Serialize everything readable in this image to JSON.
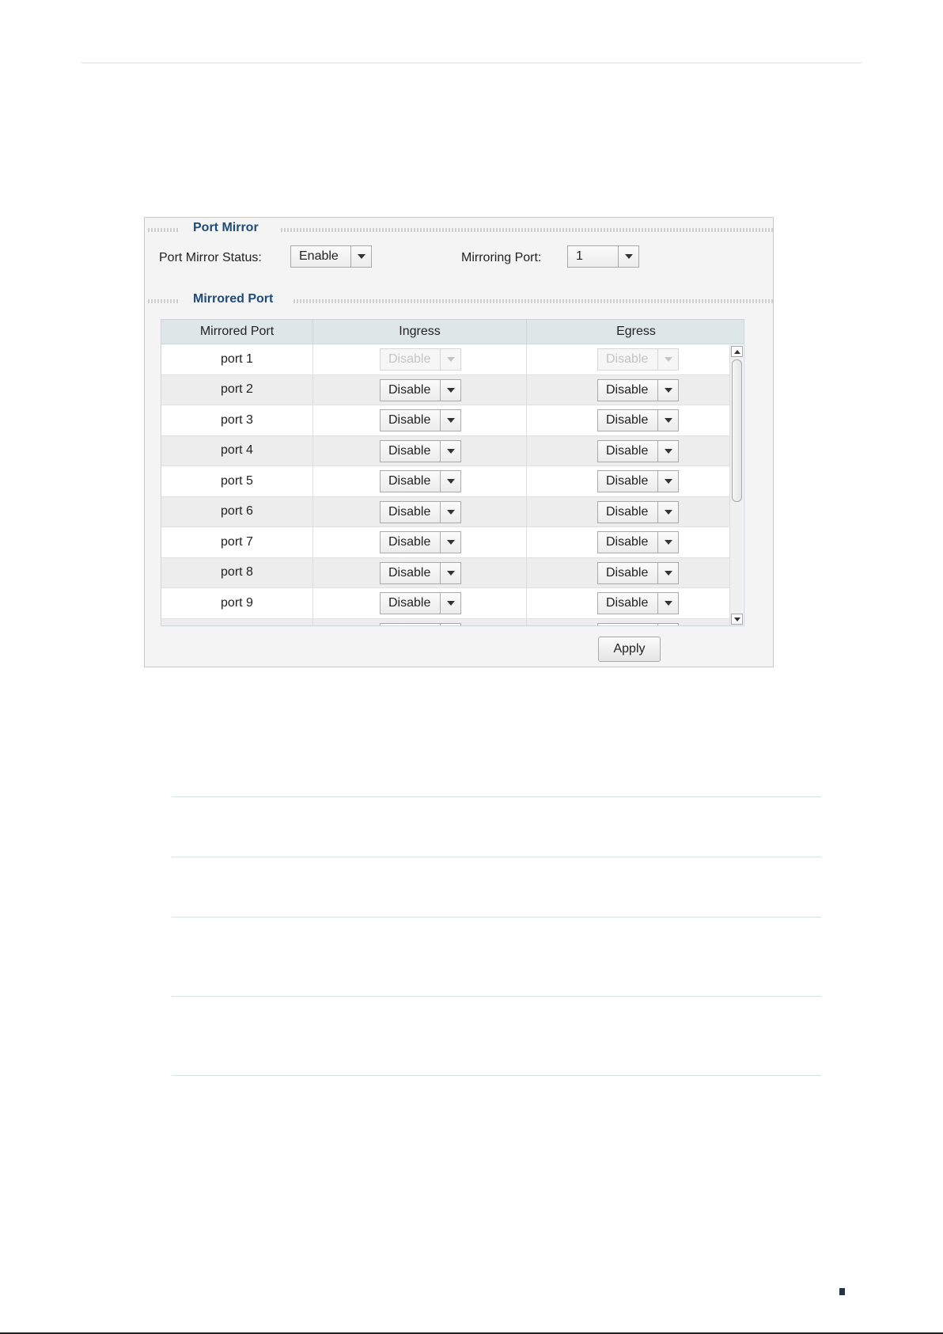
{
  "port_mirror": {
    "legend": "Port Mirror",
    "status_label": "Port Mirror Status:",
    "status_value": "Enable",
    "mirroring_port_label": "Mirroring Port:",
    "mirroring_port_value": "1"
  },
  "mirrored_port": {
    "legend": "Mirrored Port",
    "columns": [
      "Mirrored Port",
      "Ingress",
      "Egress"
    ],
    "rows": [
      {
        "port": "port 1",
        "ingress": "Disable",
        "egress": "Disable",
        "disabled": true
      },
      {
        "port": "port 2",
        "ingress": "Disable",
        "egress": "Disable",
        "disabled": false
      },
      {
        "port": "port 3",
        "ingress": "Disable",
        "egress": "Disable",
        "disabled": false
      },
      {
        "port": "port 4",
        "ingress": "Disable",
        "egress": "Disable",
        "disabled": false
      },
      {
        "port": "port 5",
        "ingress": "Disable",
        "egress": "Disable",
        "disabled": false
      },
      {
        "port": "port 6",
        "ingress": "Disable",
        "egress": "Disable",
        "disabled": false
      },
      {
        "port": "port 7",
        "ingress": "Disable",
        "egress": "Disable",
        "disabled": false
      },
      {
        "port": "port 8",
        "ingress": "Disable",
        "egress": "Disable",
        "disabled": false
      },
      {
        "port": "port 9",
        "ingress": "Disable",
        "egress": "Disable",
        "disabled": false
      },
      {
        "port": "",
        "ingress": "",
        "egress": "",
        "disabled": false
      }
    ]
  },
  "apply_label": "Apply"
}
